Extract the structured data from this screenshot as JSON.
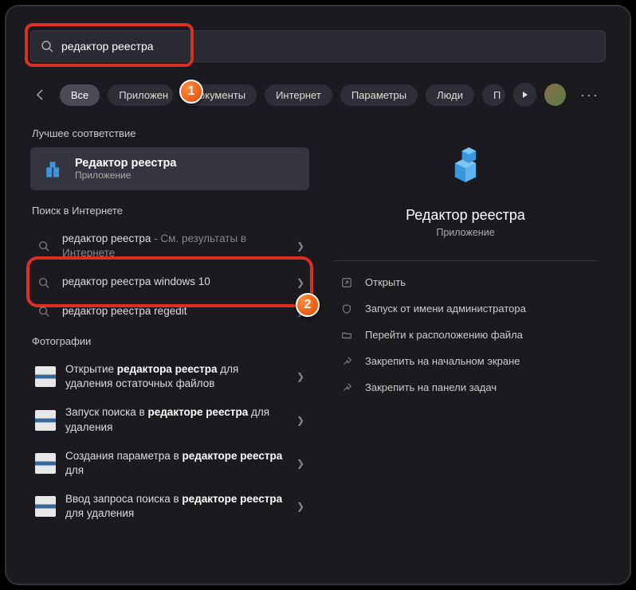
{
  "search": {
    "query": "редактор реестра"
  },
  "filters": {
    "all": "Все",
    "apps": "Приложен",
    "docs": "Документы",
    "web": "Интернет",
    "settings": "Параметры",
    "people": "Люди",
    "more_letter": "П"
  },
  "sections": {
    "best_match": "Лучшее соответствие",
    "web_search": "Поиск в Интернете",
    "photos": "Фотографии"
  },
  "best_match": {
    "title": "Редактор реестра",
    "subtitle": "Приложение"
  },
  "web_results": [
    {
      "query": "редактор реестра",
      "suffix": " - См. результаты в Интернете"
    },
    {
      "query": "редактор реестра windows 10",
      "suffix": ""
    },
    {
      "query": "редактор реестра regedit",
      "suffix": ""
    }
  ],
  "photo_results": [
    {
      "pre": "Открытие ",
      "bold": "редактора реестра",
      "post": " для удаления остаточных файлов"
    },
    {
      "pre": "Запуск поиска в ",
      "bold": "редакторе реестра",
      "post": " для удаления"
    },
    {
      "pre": "Создания параметра в ",
      "bold": "редакторе реестра",
      "post": " для"
    },
    {
      "pre": "Ввод запроса поиска в ",
      "bold": "редакторе реестра",
      "post": " для удаления"
    }
  ],
  "preview": {
    "title": "Редактор реестра",
    "subtitle": "Приложение"
  },
  "actions": {
    "open": "Открыть",
    "run_admin": "Запуск от имени администратора",
    "file_location": "Перейти к расположению файла",
    "pin_start": "Закрепить на начальном экране",
    "pin_taskbar": "Закрепить на панели задач"
  },
  "badges": {
    "one": "1",
    "two": "2"
  }
}
